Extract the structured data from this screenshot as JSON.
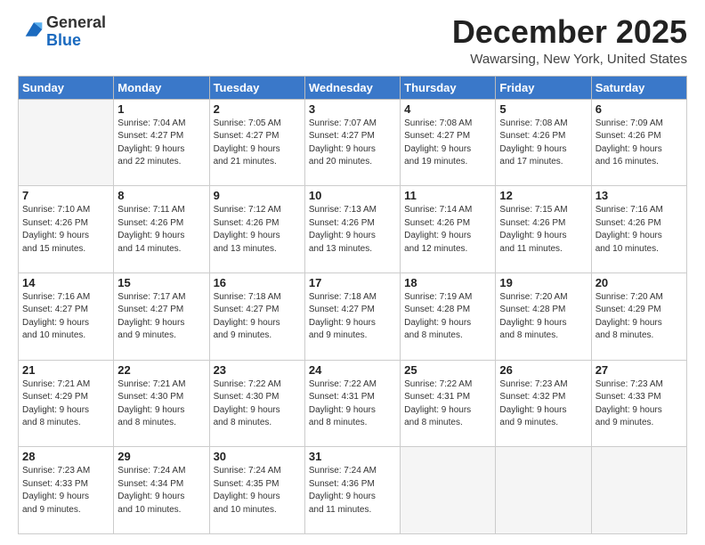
{
  "logo": {
    "general": "General",
    "blue": "Blue"
  },
  "header": {
    "month": "December 2025",
    "location": "Wawarsing, New York, United States"
  },
  "weekdays": [
    "Sunday",
    "Monday",
    "Tuesday",
    "Wednesday",
    "Thursday",
    "Friday",
    "Saturday"
  ],
  "weeks": [
    [
      {
        "day": "",
        "info": ""
      },
      {
        "day": "1",
        "info": "Sunrise: 7:04 AM\nSunset: 4:27 PM\nDaylight: 9 hours\nand 22 minutes."
      },
      {
        "day": "2",
        "info": "Sunrise: 7:05 AM\nSunset: 4:27 PM\nDaylight: 9 hours\nand 21 minutes."
      },
      {
        "day": "3",
        "info": "Sunrise: 7:07 AM\nSunset: 4:27 PM\nDaylight: 9 hours\nand 20 minutes."
      },
      {
        "day": "4",
        "info": "Sunrise: 7:08 AM\nSunset: 4:27 PM\nDaylight: 9 hours\nand 19 minutes."
      },
      {
        "day": "5",
        "info": "Sunrise: 7:08 AM\nSunset: 4:26 PM\nDaylight: 9 hours\nand 17 minutes."
      },
      {
        "day": "6",
        "info": "Sunrise: 7:09 AM\nSunset: 4:26 PM\nDaylight: 9 hours\nand 16 minutes."
      }
    ],
    [
      {
        "day": "7",
        "info": "Sunrise: 7:10 AM\nSunset: 4:26 PM\nDaylight: 9 hours\nand 15 minutes."
      },
      {
        "day": "8",
        "info": "Sunrise: 7:11 AM\nSunset: 4:26 PM\nDaylight: 9 hours\nand 14 minutes."
      },
      {
        "day": "9",
        "info": "Sunrise: 7:12 AM\nSunset: 4:26 PM\nDaylight: 9 hours\nand 13 minutes."
      },
      {
        "day": "10",
        "info": "Sunrise: 7:13 AM\nSunset: 4:26 PM\nDaylight: 9 hours\nand 13 minutes."
      },
      {
        "day": "11",
        "info": "Sunrise: 7:14 AM\nSunset: 4:26 PM\nDaylight: 9 hours\nand 12 minutes."
      },
      {
        "day": "12",
        "info": "Sunrise: 7:15 AM\nSunset: 4:26 PM\nDaylight: 9 hours\nand 11 minutes."
      },
      {
        "day": "13",
        "info": "Sunrise: 7:16 AM\nSunset: 4:26 PM\nDaylight: 9 hours\nand 10 minutes."
      }
    ],
    [
      {
        "day": "14",
        "info": "Sunrise: 7:16 AM\nSunset: 4:27 PM\nDaylight: 9 hours\nand 10 minutes."
      },
      {
        "day": "15",
        "info": "Sunrise: 7:17 AM\nSunset: 4:27 PM\nDaylight: 9 hours\nand 9 minutes."
      },
      {
        "day": "16",
        "info": "Sunrise: 7:18 AM\nSunset: 4:27 PM\nDaylight: 9 hours\nand 9 minutes."
      },
      {
        "day": "17",
        "info": "Sunrise: 7:18 AM\nSunset: 4:27 PM\nDaylight: 9 hours\nand 9 minutes."
      },
      {
        "day": "18",
        "info": "Sunrise: 7:19 AM\nSunset: 4:28 PM\nDaylight: 9 hours\nand 8 minutes."
      },
      {
        "day": "19",
        "info": "Sunrise: 7:20 AM\nSunset: 4:28 PM\nDaylight: 9 hours\nand 8 minutes."
      },
      {
        "day": "20",
        "info": "Sunrise: 7:20 AM\nSunset: 4:29 PM\nDaylight: 9 hours\nand 8 minutes."
      }
    ],
    [
      {
        "day": "21",
        "info": "Sunrise: 7:21 AM\nSunset: 4:29 PM\nDaylight: 9 hours\nand 8 minutes."
      },
      {
        "day": "22",
        "info": "Sunrise: 7:21 AM\nSunset: 4:30 PM\nDaylight: 9 hours\nand 8 minutes."
      },
      {
        "day": "23",
        "info": "Sunrise: 7:22 AM\nSunset: 4:30 PM\nDaylight: 9 hours\nand 8 minutes."
      },
      {
        "day": "24",
        "info": "Sunrise: 7:22 AM\nSunset: 4:31 PM\nDaylight: 9 hours\nand 8 minutes."
      },
      {
        "day": "25",
        "info": "Sunrise: 7:22 AM\nSunset: 4:31 PM\nDaylight: 9 hours\nand 8 minutes."
      },
      {
        "day": "26",
        "info": "Sunrise: 7:23 AM\nSunset: 4:32 PM\nDaylight: 9 hours\nand 9 minutes."
      },
      {
        "day": "27",
        "info": "Sunrise: 7:23 AM\nSunset: 4:33 PM\nDaylight: 9 hours\nand 9 minutes."
      }
    ],
    [
      {
        "day": "28",
        "info": "Sunrise: 7:23 AM\nSunset: 4:33 PM\nDaylight: 9 hours\nand 9 minutes."
      },
      {
        "day": "29",
        "info": "Sunrise: 7:24 AM\nSunset: 4:34 PM\nDaylight: 9 hours\nand 10 minutes."
      },
      {
        "day": "30",
        "info": "Sunrise: 7:24 AM\nSunset: 4:35 PM\nDaylight: 9 hours\nand 10 minutes."
      },
      {
        "day": "31",
        "info": "Sunrise: 7:24 AM\nSunset: 4:36 PM\nDaylight: 9 hours\nand 11 minutes."
      },
      {
        "day": "",
        "info": ""
      },
      {
        "day": "",
        "info": ""
      },
      {
        "day": "",
        "info": ""
      }
    ]
  ]
}
